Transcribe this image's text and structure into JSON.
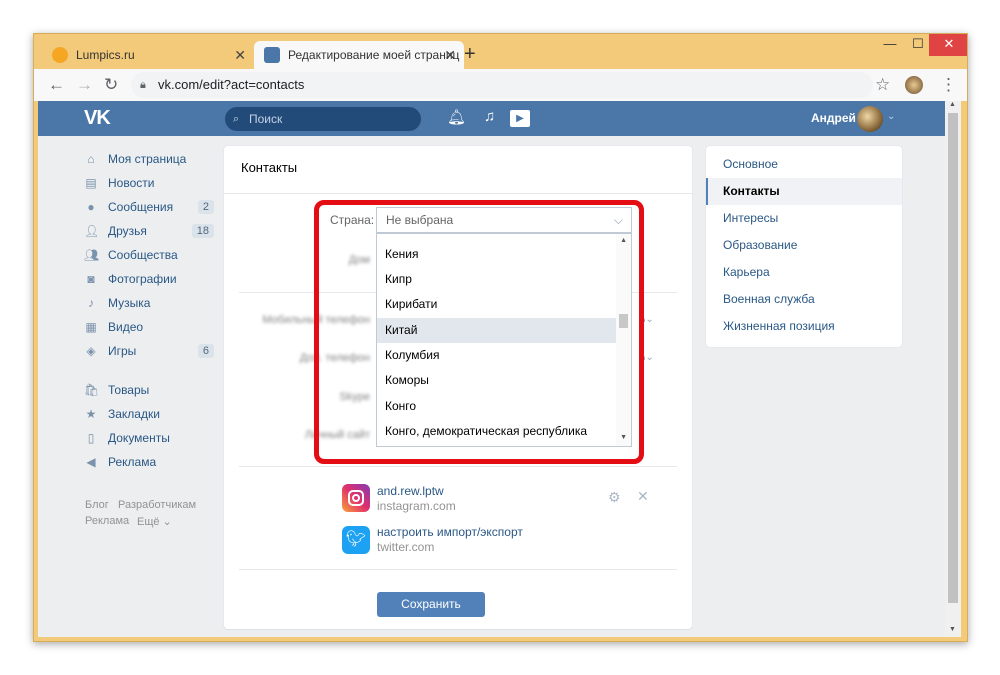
{
  "browser": {
    "tabs": [
      {
        "title": "Lumpics.ru",
        "icon": "orange-circle-icon"
      },
      {
        "title": "Редактирование моей страниц",
        "icon": "vk-icon"
      }
    ],
    "new_tab": "+",
    "close_glyph": "✕",
    "address": "vk.com/edit?act=contacts",
    "window_controls": {
      "minimize": "—",
      "maximize": "☐",
      "close": "✕"
    }
  },
  "vk_header": {
    "logo": "VK",
    "search_placeholder": "Поиск",
    "user_name": "Андрей"
  },
  "left_menu": {
    "items": [
      {
        "label": "Моя страница",
        "icon": "home-icon",
        "badge": ""
      },
      {
        "label": "Новости",
        "icon": "news-icon",
        "badge": ""
      },
      {
        "label": "Сообщения",
        "icon": "messages-icon",
        "badge": "2"
      },
      {
        "label": "Друзья",
        "icon": "friends-icon",
        "badge": "18"
      },
      {
        "label": "Сообщества",
        "icon": "communities-icon",
        "badge": ""
      },
      {
        "label": "Фотографии",
        "icon": "camera-icon",
        "badge": ""
      },
      {
        "label": "Музыка",
        "icon": "music-icon",
        "badge": ""
      },
      {
        "label": "Видео",
        "icon": "video-icon",
        "badge": ""
      },
      {
        "label": "Игры",
        "icon": "games-icon",
        "badge": "6"
      },
      {
        "label": "Товары",
        "icon": "goods-icon",
        "badge": ""
      },
      {
        "label": "Закладки",
        "icon": "star-icon",
        "badge": ""
      },
      {
        "label": "Документы",
        "icon": "document-icon",
        "badge": ""
      },
      {
        "label": "Реклама",
        "icon": "megaphone-icon",
        "badge": ""
      }
    ],
    "footer": {
      "blog": "Блог",
      "developers": "Разработчикам",
      "ads": "Реклама",
      "more": "Ещё ⌄"
    }
  },
  "contacts_card": {
    "title": "Контакты",
    "country_label": "Страна:",
    "country_value": "Не выбрана",
    "blurred_labels": [
      "Дом",
      "Мобильный телефон",
      "Доп. телефон",
      "Skype",
      "Личный сайт"
    ],
    "dropdown_options": [
      "Кения",
      "Кипр",
      "Кирибати",
      "Китай",
      "Колумбия",
      "Коморы",
      "Конго",
      "Конго, демократическая республика"
    ],
    "highlighted_option": "Китай",
    "integrations": [
      {
        "name": "and.rew.lptw",
        "service": "instagram.com",
        "icon": "instagram-icon"
      },
      {
        "name": "настроить импорт/экспорт",
        "service": "twitter.com",
        "icon": "twitter-icon"
      }
    ],
    "save_button": "Сохранить"
  },
  "right_nav": {
    "items": [
      "Основное",
      "Контакты",
      "Интересы",
      "Образование",
      "Карьера",
      "Военная служба",
      "Жизненная позиция"
    ],
    "active": "Контакты"
  },
  "colors": {
    "vk_blue": "#4a76a8",
    "button_blue": "#5181b8",
    "highlight_red": "#e40d13",
    "window_frame": "#f3c97a"
  }
}
